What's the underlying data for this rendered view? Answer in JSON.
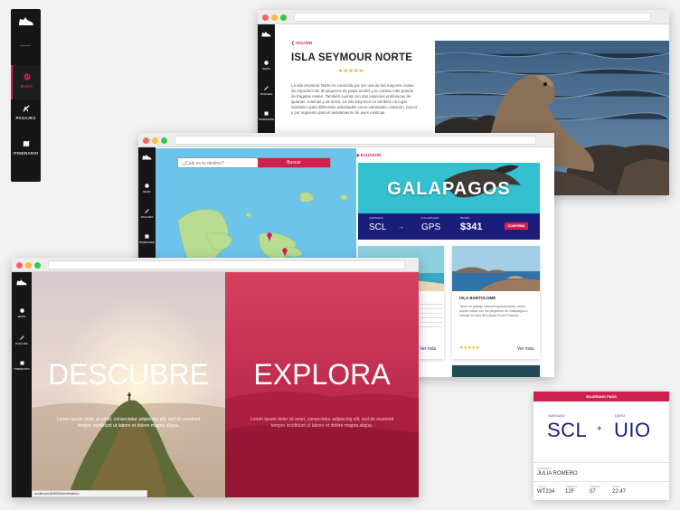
{
  "nav": {
    "items": [
      {
        "label": "MAPA",
        "icon": "globe-icon"
      },
      {
        "label": "PASAJES",
        "icon": "plane-icon"
      },
      {
        "label": "ITINERARIO",
        "icon": "map-icon"
      }
    ],
    "accent": "#d0204f"
  },
  "island_window": {
    "back": "VOLVER",
    "title": "ISLA SEYMOUR NORTE",
    "stars": "★★★★★",
    "description": "La Isla Seymour Norte es conocida por ser una de las mayores zonas de reproducción de piqueros de patas azules y la colonia más grande de fragatas reales. También cuenta con dos especies endémicas de iguanas, marinas y de tierra. La Isla Seymour es también un lugar fantástico para diferentes actividades como caminatas, natación, buceo y por supuesto para el avistamiento de aves exóticas."
  },
  "map_window": {
    "search_placeholder": "¿Cuál es tu destino?",
    "search_button": "Buscar",
    "breadcrumb": "ECUADOR",
    "hero_title": "GALAPAGOS",
    "flight": {
      "origin_label": "SANTIAGO",
      "origin": "SCL",
      "dest_label": "GALAPAGOS",
      "dest": "GPS",
      "price_label": "DESDE",
      "price": "$341",
      "confirm": "CONFIRMA"
    },
    "card": {
      "title": "ISLA BARTOLOMÉ",
      "text": "Tiene un paisaje natural impresionante, usted puede nadar con los pingüinos de Galápagos o escalar la cima del volcán Roca Pináculo.",
      "stars": "★★★★★",
      "more": "Ver más"
    },
    "more_left": "Ver más"
  },
  "landing_window": {
    "left_title": "DESCUBRE",
    "right_title": "EXPLORA",
    "left_text": "Lorem ipsum dolor sit amet, consectetur adipiscing elit, sed do eiusmod tempor incididunt ut labore et dolore magna aliqua.",
    "right_text": "Lorem ipsum dolor sit amet, consectetur adipiscing elit, sed do eiusmod tempor incididunt ut labore et dolore magna aliqua.",
    "status_url": "localhost:8080/#/destination"
  },
  "boarding_pass": {
    "header": "BOARDING PASS",
    "from_label": "SANTIAGO",
    "from": "SCL",
    "to_label": "QUITO",
    "to": "UIO",
    "passenger_label": "PASAJERO",
    "passenger": "JULIA ROMERO",
    "fields": [
      {
        "label": "VUELO",
        "value": "WT234"
      },
      {
        "label": "ASIENTO",
        "value": "12F"
      },
      {
        "label": "PUERTA",
        "value": "07"
      },
      {
        "label": "HORA",
        "value": "22:47"
      }
    ]
  }
}
